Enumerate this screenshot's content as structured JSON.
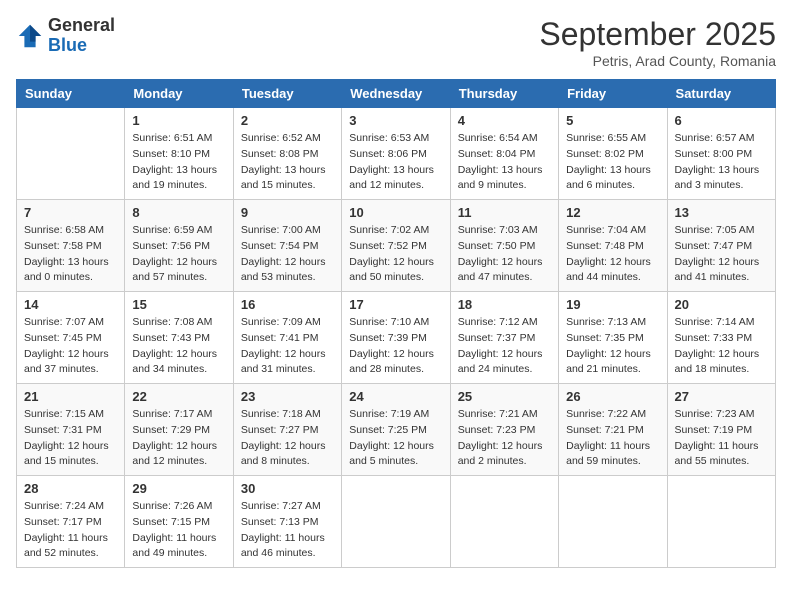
{
  "header": {
    "logo_line1": "General",
    "logo_line2": "Blue",
    "month_title": "September 2025",
    "location": "Petris, Arad County, Romania"
  },
  "weekdays": [
    "Sunday",
    "Monday",
    "Tuesday",
    "Wednesday",
    "Thursday",
    "Friday",
    "Saturday"
  ],
  "weeks": [
    [
      {
        "day": "",
        "info": ""
      },
      {
        "day": "1",
        "info": "Sunrise: 6:51 AM\nSunset: 8:10 PM\nDaylight: 13 hours\nand 19 minutes."
      },
      {
        "day": "2",
        "info": "Sunrise: 6:52 AM\nSunset: 8:08 PM\nDaylight: 13 hours\nand 15 minutes."
      },
      {
        "day": "3",
        "info": "Sunrise: 6:53 AM\nSunset: 8:06 PM\nDaylight: 13 hours\nand 12 minutes."
      },
      {
        "day": "4",
        "info": "Sunrise: 6:54 AM\nSunset: 8:04 PM\nDaylight: 13 hours\nand 9 minutes."
      },
      {
        "day": "5",
        "info": "Sunrise: 6:55 AM\nSunset: 8:02 PM\nDaylight: 13 hours\nand 6 minutes."
      },
      {
        "day": "6",
        "info": "Sunrise: 6:57 AM\nSunset: 8:00 PM\nDaylight: 13 hours\nand 3 minutes."
      }
    ],
    [
      {
        "day": "7",
        "info": "Sunrise: 6:58 AM\nSunset: 7:58 PM\nDaylight: 13 hours\nand 0 minutes."
      },
      {
        "day": "8",
        "info": "Sunrise: 6:59 AM\nSunset: 7:56 PM\nDaylight: 12 hours\nand 57 minutes."
      },
      {
        "day": "9",
        "info": "Sunrise: 7:00 AM\nSunset: 7:54 PM\nDaylight: 12 hours\nand 53 minutes."
      },
      {
        "day": "10",
        "info": "Sunrise: 7:02 AM\nSunset: 7:52 PM\nDaylight: 12 hours\nand 50 minutes."
      },
      {
        "day": "11",
        "info": "Sunrise: 7:03 AM\nSunset: 7:50 PM\nDaylight: 12 hours\nand 47 minutes."
      },
      {
        "day": "12",
        "info": "Sunrise: 7:04 AM\nSunset: 7:48 PM\nDaylight: 12 hours\nand 44 minutes."
      },
      {
        "day": "13",
        "info": "Sunrise: 7:05 AM\nSunset: 7:47 PM\nDaylight: 12 hours\nand 41 minutes."
      }
    ],
    [
      {
        "day": "14",
        "info": "Sunrise: 7:07 AM\nSunset: 7:45 PM\nDaylight: 12 hours\nand 37 minutes."
      },
      {
        "day": "15",
        "info": "Sunrise: 7:08 AM\nSunset: 7:43 PM\nDaylight: 12 hours\nand 34 minutes."
      },
      {
        "day": "16",
        "info": "Sunrise: 7:09 AM\nSunset: 7:41 PM\nDaylight: 12 hours\nand 31 minutes."
      },
      {
        "day": "17",
        "info": "Sunrise: 7:10 AM\nSunset: 7:39 PM\nDaylight: 12 hours\nand 28 minutes."
      },
      {
        "day": "18",
        "info": "Sunrise: 7:12 AM\nSunset: 7:37 PM\nDaylight: 12 hours\nand 24 minutes."
      },
      {
        "day": "19",
        "info": "Sunrise: 7:13 AM\nSunset: 7:35 PM\nDaylight: 12 hours\nand 21 minutes."
      },
      {
        "day": "20",
        "info": "Sunrise: 7:14 AM\nSunset: 7:33 PM\nDaylight: 12 hours\nand 18 minutes."
      }
    ],
    [
      {
        "day": "21",
        "info": "Sunrise: 7:15 AM\nSunset: 7:31 PM\nDaylight: 12 hours\nand 15 minutes."
      },
      {
        "day": "22",
        "info": "Sunrise: 7:17 AM\nSunset: 7:29 PM\nDaylight: 12 hours\nand 12 minutes."
      },
      {
        "day": "23",
        "info": "Sunrise: 7:18 AM\nSunset: 7:27 PM\nDaylight: 12 hours\nand 8 minutes."
      },
      {
        "day": "24",
        "info": "Sunrise: 7:19 AM\nSunset: 7:25 PM\nDaylight: 12 hours\nand 5 minutes."
      },
      {
        "day": "25",
        "info": "Sunrise: 7:21 AM\nSunset: 7:23 PM\nDaylight: 12 hours\nand 2 minutes."
      },
      {
        "day": "26",
        "info": "Sunrise: 7:22 AM\nSunset: 7:21 PM\nDaylight: 11 hours\nand 59 minutes."
      },
      {
        "day": "27",
        "info": "Sunrise: 7:23 AM\nSunset: 7:19 PM\nDaylight: 11 hours\nand 55 minutes."
      }
    ],
    [
      {
        "day": "28",
        "info": "Sunrise: 7:24 AM\nSunset: 7:17 PM\nDaylight: 11 hours\nand 52 minutes."
      },
      {
        "day": "29",
        "info": "Sunrise: 7:26 AM\nSunset: 7:15 PM\nDaylight: 11 hours\nand 49 minutes."
      },
      {
        "day": "30",
        "info": "Sunrise: 7:27 AM\nSunset: 7:13 PM\nDaylight: 11 hours\nand 46 minutes."
      },
      {
        "day": "",
        "info": ""
      },
      {
        "day": "",
        "info": ""
      },
      {
        "day": "",
        "info": ""
      },
      {
        "day": "",
        "info": ""
      }
    ]
  ]
}
